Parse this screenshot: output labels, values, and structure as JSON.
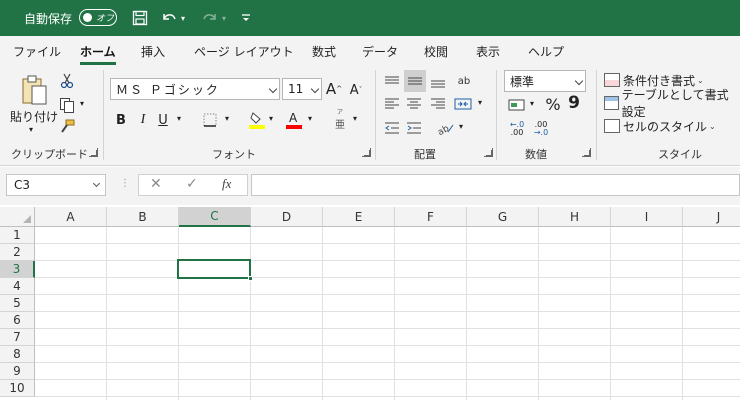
{
  "titlebar": {
    "autosave_label": "自動保存",
    "autosave_state": "オフ"
  },
  "tabs": [
    "ファイル",
    "ホーム",
    "挿入",
    "ページ レイアウト",
    "数式",
    "データ",
    "校閲",
    "表示",
    "ヘルプ"
  ],
  "active_tab": "ホーム",
  "ribbon": {
    "clipboard": {
      "paste_label": "貼り付け",
      "group_label": "クリップボード"
    },
    "font": {
      "font_name": "ＭＳ Ｐゴシック",
      "font_size": "11",
      "grow": "A",
      "shrink": "A",
      "bold": "B",
      "italic": "I",
      "underline": "U",
      "furigana": "亜",
      "group_label": "フォント"
    },
    "alignment": {
      "group_label": "配置",
      "wrap_glyph": "ab"
    },
    "number": {
      "format": "標準",
      "percent": "%",
      "comma": "9",
      "inc_decimal": ".00",
      "dec_decimal": ".00",
      "group_label": "数値"
    },
    "styles": {
      "conditional": "条件付き書式",
      "table": "テーブルとして書式設定",
      "cell": "セルのスタイル",
      "group_label": "スタイル"
    }
  },
  "formula_bar": {
    "name_box": "C3",
    "fx": "fx",
    "cancel": "✕",
    "enter": "✓",
    "content": ""
  },
  "grid": {
    "columns": [
      "A",
      "B",
      "C",
      "D",
      "E",
      "F",
      "G",
      "H",
      "I",
      "J"
    ],
    "rows": [
      "1",
      "2",
      "3",
      "4",
      "5",
      "6",
      "7",
      "8",
      "9",
      "10"
    ],
    "selected_cell": "C3"
  },
  "colors": {
    "accent": "#217346",
    "ribbon_bg": "#f3f3f3",
    "highlight_yellow": "#ffff00",
    "font_red": "#ff0000"
  },
  "icons": [
    "save-icon",
    "undo-icon",
    "redo-icon",
    "customize-qat-icon",
    "paste-icon",
    "cut-icon",
    "copy-icon",
    "format-painter-icon",
    "borders-icon",
    "fill-color-icon",
    "font-color-icon",
    "currency-icon",
    "conditional-format-icon",
    "table-format-icon",
    "cell-styles-icon"
  ]
}
